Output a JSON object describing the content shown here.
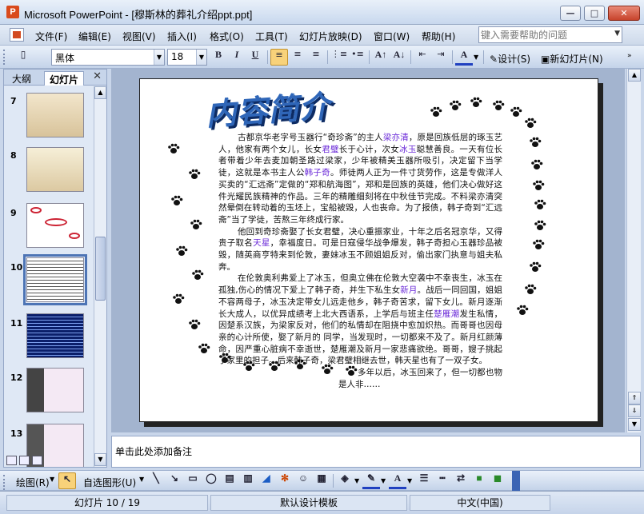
{
  "window": {
    "title": "Microsoft PowerPoint - [穆斯林的葬礼介绍ppt.ppt]",
    "minimize": "—",
    "maximize": "□",
    "close": "✕"
  },
  "menu": {
    "items": [
      "文件(F)",
      "编辑(E)",
      "视图(V)",
      "插入(I)",
      "格式(O)",
      "工具(T)",
      "幻灯片放映(D)",
      "窗口(W)",
      "帮助(H)"
    ],
    "help_placeholder": "键入需要帮助的问题"
  },
  "toolbar": {
    "font": "黑体",
    "size": "18",
    "bold": "B",
    "italic": "I",
    "underline": "U",
    "design_label": "设计(S)",
    "new_slide_label": "新幻灯片(N)"
  },
  "pane": {
    "tab_outline": "大纲",
    "tab_slides": "幻灯片",
    "close": "✕",
    "thumbs": [
      "7",
      "8",
      "9",
      "10",
      "11",
      "12",
      "13"
    ],
    "selected": "10"
  },
  "slide": {
    "title": "内容简介",
    "p1_a": "古都京华老字号玉器行“奇珍斋”的主人",
    "p1_h1": "梁亦清",
    "p1_b": "，原是回族低层的琢玉艺人，他家有两个女儿，长女",
    "p1_h2": "君璧",
    "p1_c": "长于心计，次女",
    "p1_h3": "冰玉",
    "p1_d": "聪慧善良。一天有位长者带着少年去麦加朝圣路过梁家，少年被精美玉器所吸引，决定留下当学徒，这就是本书主人公",
    "p1_h4": "韩子奇",
    "p1_e": "。师徒两人正为一件寸货劳作，这是专做洋人买卖的“汇远斋”定做的“郑和航海图”，郑和是回族的英雄，他们决心做好这件光耀民族精神的作品。三年的精雕细刻将在中秋佳节完成。不料梁亦清突然晕倒在转动着的玉坯上，宝船被毁，人也丧命。为了报债，韩子奇到“汇远斋”当了学徒，苦熬三年终成行家。",
    "p2_a": "他回到奇珍斋娶了长女君璧，决心重振家业，十年之后名冠京华，又得贵子取名",
    "p2_h1": "天星",
    "p2_b": "，幸福度日。可是日寇侵华战争爆发，韩子奇担心玉器珍品被毁，随英商亨特来到伦敦，妻妹冰玉不顾姐姐反对，偷出家门执意与姐夫私奔。",
    "p3_a": "在伦敦奥利弗爱上了冰玉，但奥立佛在伦敦大空袭中不幸丧生，冰玉在孤独,伤心的情况下爱上了韩子奇，并生下私生女",
    "p3_h1": "新月",
    "p3_b": "。战后一同回国，姐姐不容两母子，冰玉决定带女儿远走他乡，韩子奇苦求，留下女儿。新月逐渐长大成人，以优异成绩考上北大西语系，上学后与班主任",
    "p3_h2": "楚雁潮",
    "p3_c": "发生私情，因楚系汉族，为梁家反对，他们的私情却在阻挠中愈加炽热。而哥哥也因母亲的心计所使，娶了新月的 同学，当发现时，一切都来不及了。新月红颜薄命，因严重心脏病不幸逝世，楚雁潮及新月一家悲痛欲绝。哥哥，嫂子挑起了家里的担子。后来韩子奇，梁君璧相继去世，韩天星也有了一双子女。",
    "p4": "多年以后，冰玉回来了，但一切都也物是人非……"
  },
  "notes": {
    "placeholder": "单击此处添加备注"
  },
  "drawbar": {
    "draw_label": "绘图(R)",
    "autoshape_label": "自选图形(U)"
  },
  "status": {
    "slide_label": "幻灯片 10 / 19",
    "template": "默认设计模板",
    "language": "中文(中国)"
  },
  "colors": {
    "highlight": "#6b2bd8",
    "title": "#2f66b8",
    "selected_outline": "#4d74b5"
  }
}
